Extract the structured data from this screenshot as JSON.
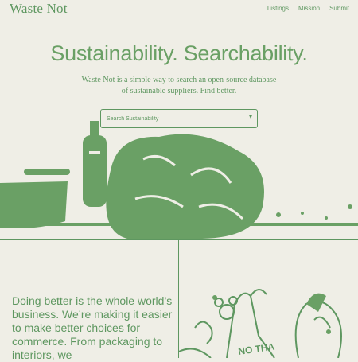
{
  "header": {
    "logo": "Waste Not",
    "nav": [
      "Listings",
      "Mission",
      "Submit"
    ]
  },
  "hero": {
    "title": "Sustainability. Searchability.",
    "subtitle": "Waste Not is a simple way to search an open-source database of sustainable suppliers. Find better.",
    "search": {
      "placeholder": "Search Sustainability"
    }
  },
  "mission": {
    "text": "Doing better is the whole world’s business. We’re making it easier to make better choices for commerce. From packaging to interiors, we"
  },
  "illustration": {
    "label_text": "NO THA"
  },
  "colors": {
    "accent": "#5e9760",
    "background": "#efeee6"
  }
}
